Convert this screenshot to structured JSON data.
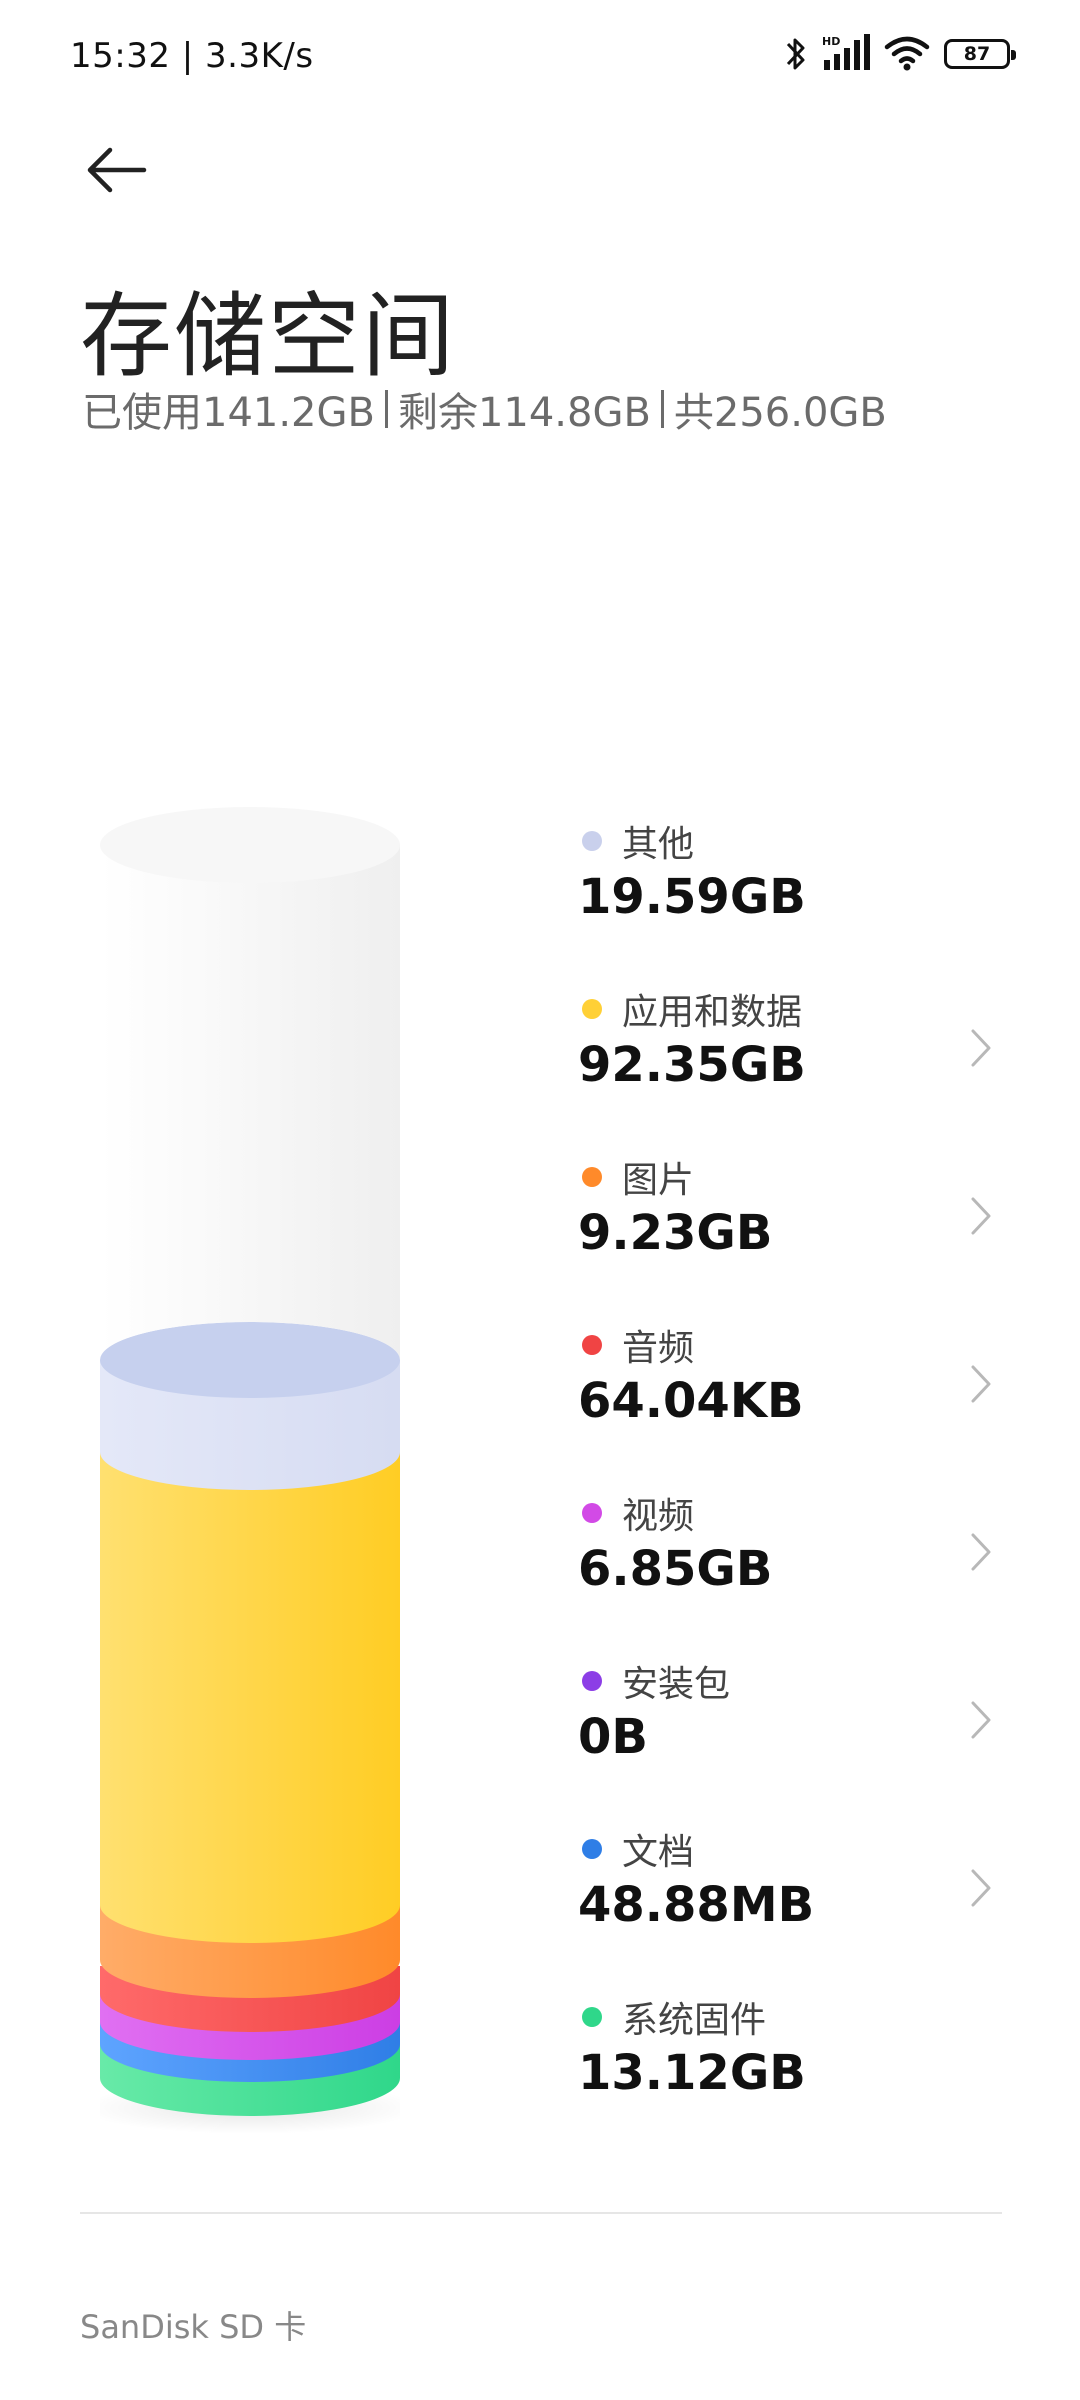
{
  "status_bar": {
    "time_speed": "15:32 | 3.3K/s",
    "icons": [
      "bluetooth-icon",
      "hd-signal-icon",
      "wifi-icon",
      "battery-icon"
    ],
    "hd_label": "HD",
    "battery_level": "87"
  },
  "header": {
    "back_icon": "back-arrow-icon",
    "title": "存储空间",
    "summary": {
      "used": "已使用141.2GB",
      "remaining": "剩余114.8GB",
      "total": "共256.0GB"
    }
  },
  "categories": [
    {
      "label": "其他",
      "value": "19.59GB",
      "color": "#c9d0ec",
      "has_chevron": false
    },
    {
      "label": "应用和数据",
      "value": "92.35GB",
      "color": "#ffd036",
      "has_chevron": true
    },
    {
      "label": "图片",
      "value": "9.23GB",
      "color": "#ff8a2a",
      "has_chevron": true
    },
    {
      "label": "音频",
      "value": "64.04KB",
      "color": "#f04444",
      "has_chevron": true
    },
    {
      "label": "视频",
      "value": "6.85GB",
      "color": "#d24ae6",
      "has_chevron": true
    },
    {
      "label": "安装包",
      "value": "0B",
      "color": "#8c3ee6",
      "has_chevron": true
    },
    {
      "label": "文档",
      "value": "48.88MB",
      "color": "#2f7ee6",
      "has_chevron": true
    },
    {
      "label": "系统固件",
      "value": "13.12GB",
      "color": "#2fd78a",
      "has_chevron": false
    }
  ],
  "footer": {
    "sd_card_label": "SanDisk SD 卡"
  }
}
